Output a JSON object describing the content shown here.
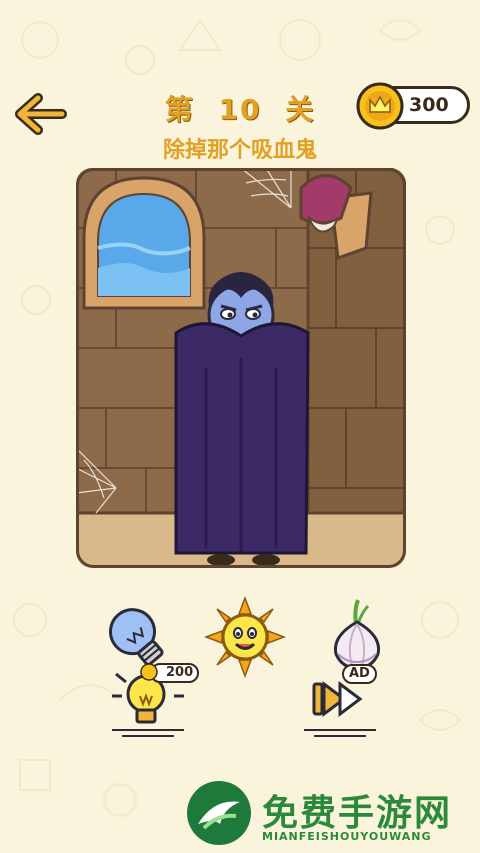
{
  "header": {
    "level_prefix": "第",
    "level_number": "10",
    "level_suffix": "关",
    "coins": "300"
  },
  "puzzle": {
    "instruction": "除掉那个吸血鬼"
  },
  "items": [
    {
      "name": "light-bulb",
      "icon": "lightbulb-icon"
    },
    {
      "name": "sun",
      "icon": "sun-icon"
    },
    {
      "name": "garlic",
      "icon": "garlic-icon"
    }
  ],
  "actions": {
    "hint_cost": "200",
    "ad_label": "AD"
  },
  "watermark": {
    "title": "免费手游网",
    "subtitle": "MIANFEISHOUYOUWANG"
  },
  "colors": {
    "background": "#fbf4dc",
    "title": "#e0a125",
    "wall": "#8c6a4a",
    "cape": "#3b2a66",
    "vampire_skin": "#8fa6e6"
  }
}
